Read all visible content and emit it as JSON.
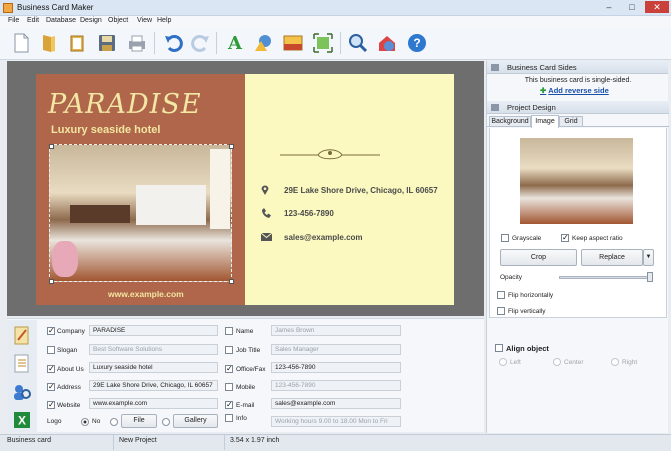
{
  "window": {
    "title": "Business Card Maker"
  },
  "menu": [
    "File",
    "Edit",
    "Database",
    "Design",
    "Object",
    "View",
    "Help"
  ],
  "toolbar": {
    "icons": [
      "new-doc-icon",
      "open-folder-icon",
      "clipboard-icon",
      "save-icon",
      "print-icon",
      "undo-icon",
      "redo-icon",
      "text-icon",
      "shapes-icon",
      "image-icon",
      "fit-icon",
      "zoom-icon",
      "web-icon",
      "help-icon"
    ]
  },
  "card": {
    "logo": "PARADISE",
    "tagline": "Luxury seaside hotel",
    "website": "www.example.com",
    "address": "29E Lake Shore Drive, Chicago, IL 60657",
    "phone": "123-456-7890",
    "email": "sales@example.com"
  },
  "sides": {
    "header": "Business Card Sides",
    "note": "This business card is single-sided.",
    "add_link": "Add reverse side"
  },
  "design": {
    "header": "Project Design",
    "tabs": [
      "Background",
      "Image",
      "Grid"
    ],
    "grayscale": "Grayscale",
    "keep_aspect": "Keep aspect ratio",
    "crop": "Crop",
    "replace": "Replace",
    "opacity": "Opacity",
    "flip_h": "Flip horizontally",
    "flip_v": "Flip vertically",
    "align_header": "Align object",
    "align_left": "Left",
    "align_center": "Center",
    "align_right": "Right"
  },
  "form": {
    "left": [
      {
        "label": "Company",
        "checked": true,
        "value": "PARADISE",
        "placeholder": false
      },
      {
        "label": "Slogan",
        "checked": false,
        "value": "Best Software Solutions",
        "placeholder": true
      },
      {
        "label": "About Us",
        "checked": true,
        "value": "Luxury seaside hotel",
        "placeholder": false
      },
      {
        "label": "Address",
        "checked": true,
        "value": "29E Lake Shore Drive, Chicago, IL 60657",
        "placeholder": false
      },
      {
        "label": "Website",
        "checked": true,
        "value": "www.example.com",
        "placeholder": false
      }
    ],
    "right": [
      {
        "label": "Name",
        "checked": false,
        "value": "James Brown",
        "placeholder": true
      },
      {
        "label": "Job Title",
        "checked": false,
        "value": "Sales Manager",
        "placeholder": true
      },
      {
        "label": "Office/Fax",
        "checked": true,
        "value": "123-456-7890",
        "placeholder": false
      },
      {
        "label": "Mobile",
        "checked": false,
        "value": "123-456-7890",
        "placeholder": true
      },
      {
        "label": "E-mail",
        "checked": true,
        "value": "sales@example.com",
        "placeholder": false
      },
      {
        "label": "Info",
        "checked": false,
        "value": "Working hours 9.00 to 18.00 Mon to Fri",
        "placeholder": true
      }
    ],
    "logo_label": "Logo",
    "logo_no": "No",
    "logo_file": "File",
    "logo_gallery": "Gallery"
  },
  "status": {
    "left": "Business card",
    "mid": "New Project",
    "size": "3.54 x 1.97 inch"
  }
}
